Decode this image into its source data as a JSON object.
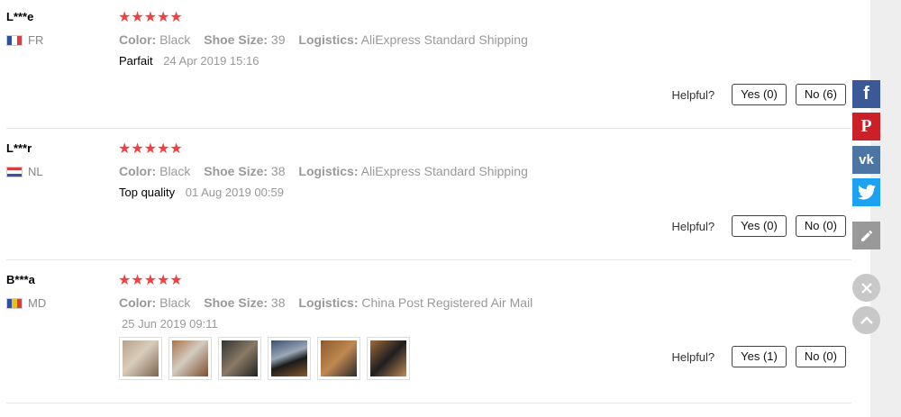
{
  "reviews": [
    {
      "user": "L***e",
      "country": "FR",
      "stars": "★★★★★",
      "color_label": "Color:",
      "color": "Black",
      "size_label": "Shoe Size:",
      "size": "39",
      "logistics_label": "Logistics:",
      "logistics": "AliExpress Standard Shipping",
      "text": "Parfait",
      "date": "24 Apr 2019 15:16",
      "helpful_label": "Helpful?",
      "yes": "Yes (0)",
      "no": "No (6)"
    },
    {
      "user": "L***r",
      "country": "NL",
      "stars": "★★★★★",
      "color_label": "Color:",
      "color": "Black",
      "size_label": "Shoe Size:",
      "size": "38",
      "logistics_label": "Logistics:",
      "logistics": "AliExpress Standard Shipping",
      "text": "Top quality",
      "date": "01 Aug 2019 00:59",
      "helpful_label": "Helpful?",
      "yes": "Yes (0)",
      "no": "No (0)"
    },
    {
      "user": "B***a",
      "country": "MD",
      "stars": "★★★★★",
      "color_label": "Color:",
      "color": "Black",
      "size_label": "Shoe Size:",
      "size": "38",
      "logistics_label": "Logistics:",
      "logistics": "China Post Registered Air Mail",
      "text": "",
      "date": "25 Jun 2019 09:11",
      "helpful_label": "Helpful?",
      "yes": "Yes (1)",
      "no": "No (0)",
      "photo_count": 6
    }
  ],
  "share_bar": {
    "facebook_glyph": "f",
    "pinterest_glyph": "P",
    "vk_glyph": "vk",
    "icons": [
      "facebook-icon",
      "pinterest-icon",
      "vk-icon",
      "twitter-icon",
      "pencil-icon",
      "close-icon",
      "chevron-up-icon"
    ],
    "colors": {
      "facebook": "#3b5998",
      "pinterest": "#cb2027",
      "vk": "#4c75a3",
      "twitter": "#1da1f2",
      "edit": "#999999"
    }
  },
  "colors": {
    "stars": "#f04040",
    "muted": "#999999"
  }
}
